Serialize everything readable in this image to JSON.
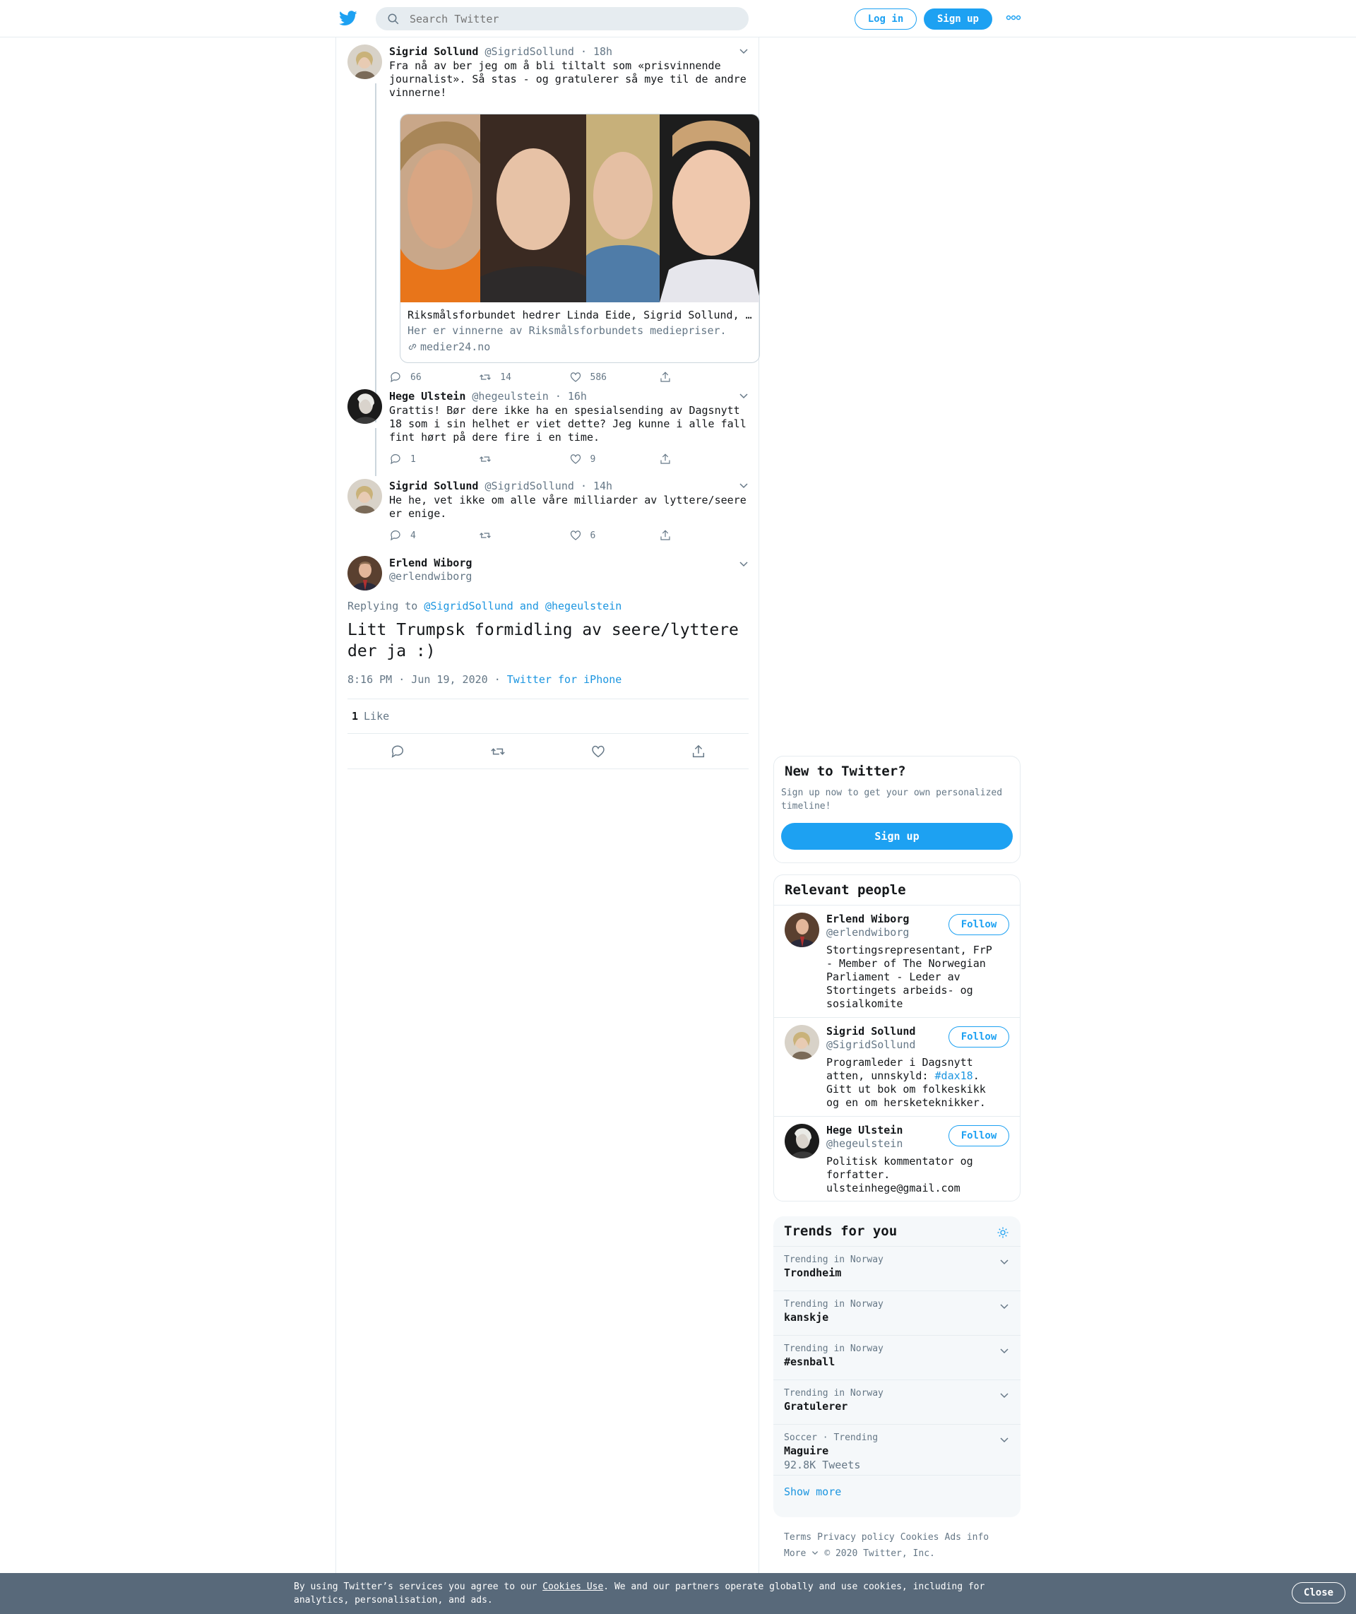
{
  "header": {
    "search_placeholder": "Search Twitter",
    "login_label": "Log in",
    "signup_label": "Sign up"
  },
  "thread": [
    {
      "name": "Sigrid Sollund",
      "handle": "@SigridSollund",
      "time": "· 18h",
      "text": "Fra nå av ber jeg om å bli tiltalt som «prisvinnende journalist». Så stas - og gratulerer så mye til de andre vinnerne!",
      "card": {
        "title": "Riksmålsforbundet hedrer Linda Eide, Sigrid Sollund, …",
        "description": "Her er vinnerne av Riksmålsforbundets mediepriser.",
        "url": "medier24.no"
      },
      "replies": "66",
      "retweets": "14",
      "likes": "586"
    },
    {
      "name": "Hege Ulstein",
      "handle": "@hegeulstein",
      "time": "· 16h",
      "text": "Grattis! Bør dere ikke ha en spesialsending av Dagsnytt 18 som i sin helhet er viet dette? Jeg kunne i alle fall fint hørt på dere fire i en time.",
      "replies": "1",
      "retweets": "",
      "likes": "9"
    },
    {
      "name": "Sigrid Sollund",
      "handle": "@SigridSollund",
      "time": "· 14h",
      "text": "He he, vet ikke om alle våre milliarder av lyttere/seere er enige.",
      "replies": "4",
      "retweets": "",
      "likes": "6"
    }
  ],
  "focal": {
    "name": "Erlend Wiborg",
    "handle": "@erlendwiborg",
    "replying_prefix": "Replying to ",
    "replying_to": "@SigridSollund and @hegeulstein",
    "text": "Litt Trumpsk formidling av seere/lyttere der ja :)",
    "timestamp": "8:16 PM · Jun 19, 2020",
    "meta_sep": " · ",
    "source": "Twitter for iPhone",
    "like_count": "1",
    "like_label": "Like"
  },
  "sidebar": {
    "new_to_twitter": {
      "title": "New to Twitter?",
      "text": "Sign up now to get your own personalized timeline!",
      "button": "Sign up"
    },
    "relevant_people": {
      "title": "Relevant people",
      "follow_label": "Follow",
      "people": [
        {
          "name": "Erlend Wiborg",
          "handle": "@erlendwiborg",
          "bio": "Stortingsrepresentant, FrP - Member of The Norwegian Parliament - Leder av Stortingets arbeids- og sosialkomite"
        },
        {
          "name": "Sigrid Sollund",
          "handle": "@SigridSollund",
          "bio_a": "Programleder i Dagsnytt atten, unnskyld: ",
          "bio_tag": "#dax18",
          "bio_b": ". Gitt ut bok om folkeskikk og en om hersketeknikker."
        },
        {
          "name": "Hege Ulstein",
          "handle": "@hegeulstein",
          "bio": "Politisk kommentator og forfatter. ulsteinhege@gmail.com"
        }
      ]
    },
    "trends": {
      "title": "Trends for you",
      "items": [
        {
          "context": "Trending in Norway",
          "name": "Trondheim",
          "tweets": ""
        },
        {
          "context": "Trending in Norway",
          "name": "kanskje",
          "tweets": ""
        },
        {
          "context": "Trending in Norway",
          "name": "#esnball",
          "tweets": ""
        },
        {
          "context": "Trending in Norway",
          "name": "Gratulerer",
          "tweets": ""
        },
        {
          "context": "Soccer · Trending",
          "name": "Maguire",
          "tweets": "92.8K Tweets"
        }
      ],
      "show_more": "Show more"
    },
    "footer": {
      "links": [
        "Terms",
        "Privacy policy",
        "Cookies",
        "Ads info"
      ],
      "more": "More",
      "copyright": "© 2020 Twitter, Inc."
    }
  },
  "cookie_banner": {
    "text_a": "By using Twitter’s services you agree to our ",
    "link": "Cookies Use",
    "text_b": ". We and our partners operate globally and use cookies, including for analytics, personalisation, and ads.",
    "close": "Close"
  },
  "colors": {
    "accent": "#1da1f2",
    "link": "#1b95e0",
    "muted": "#657786",
    "banner": "#58697a"
  }
}
